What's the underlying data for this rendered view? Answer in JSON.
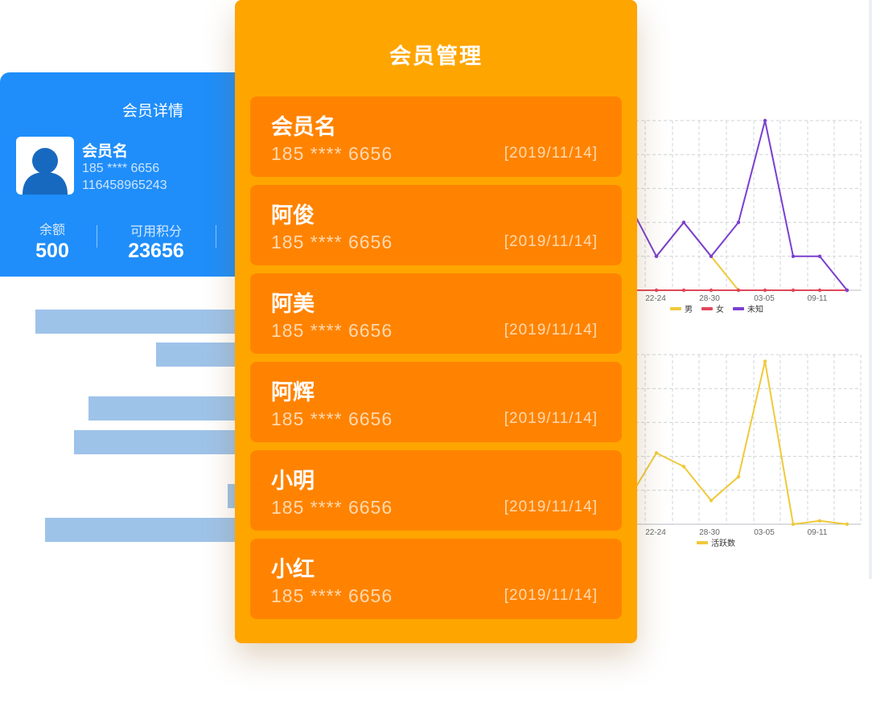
{
  "detail_card": {
    "title": "会员详情",
    "member_name": "会员名",
    "phone": "185 **** 6656",
    "card_no": "116458965243",
    "stats": [
      {
        "label": "余额",
        "value": "500"
      },
      {
        "label": "可用积分",
        "value": "23656"
      }
    ],
    "colors": {
      "card": "#1f8efa",
      "bars": "#9ec3e9"
    }
  },
  "member_panel": {
    "title": "会员管理",
    "colors": {
      "panel": "#ffa500",
      "item": "#ff8300"
    },
    "members": [
      {
        "name": "会员名",
        "phone": "185 **** 6656",
        "date": "[2019/11/14]"
      },
      {
        "name": "阿俊",
        "phone": "185 **** 6656",
        "date": "[2019/11/14]"
      },
      {
        "name": "阿美",
        "phone": "185 **** 6656",
        "date": "[2019/11/14]"
      },
      {
        "name": "阿辉",
        "phone": "185 **** 6656",
        "date": "[2019/11/14]"
      },
      {
        "name": "小明",
        "phone": "185 **** 6656",
        "date": "[2019/11/14]"
      },
      {
        "name": "小红",
        "phone": "185 **** 6656",
        "date": "[2019/11/14]"
      }
    ]
  },
  "chart_data": [
    {
      "type": "line",
      "x_ticks": [
        "22-24",
        "28-30",
        "03-05",
        "09-11"
      ],
      "ylim": [
        0,
        5
      ],
      "grid": true,
      "legend_position": "bottom",
      "series": [
        {
          "name": "男",
          "color": "#f0c93a",
          "values": [
            null,
            1,
            2,
            1,
            0,
            null,
            null,
            null,
            null
          ]
        },
        {
          "name": "女",
          "color": "#e0475b",
          "values": [
            0,
            0,
            0,
            0,
            0,
            0,
            0,
            0,
            0
          ]
        },
        {
          "name": "未知",
          "color": "#7a3fd0",
          "values": [
            2.5,
            1,
            2,
            1,
            2,
            5,
            1,
            1,
            0
          ]
        }
      ]
    },
    {
      "type": "line",
      "x_ticks": [
        "22-24",
        "28-30",
        "03-05",
        "09-11"
      ],
      "ylim": [
        0,
        5
      ],
      "grid": true,
      "legend_position": "bottom",
      "series": [
        {
          "name": "活跃数",
          "color": "#f0c93a",
          "values": [
            0.8,
            2.1,
            1.7,
            0.7,
            1.4,
            4.8,
            0,
            0.1,
            0
          ]
        }
      ]
    }
  ]
}
